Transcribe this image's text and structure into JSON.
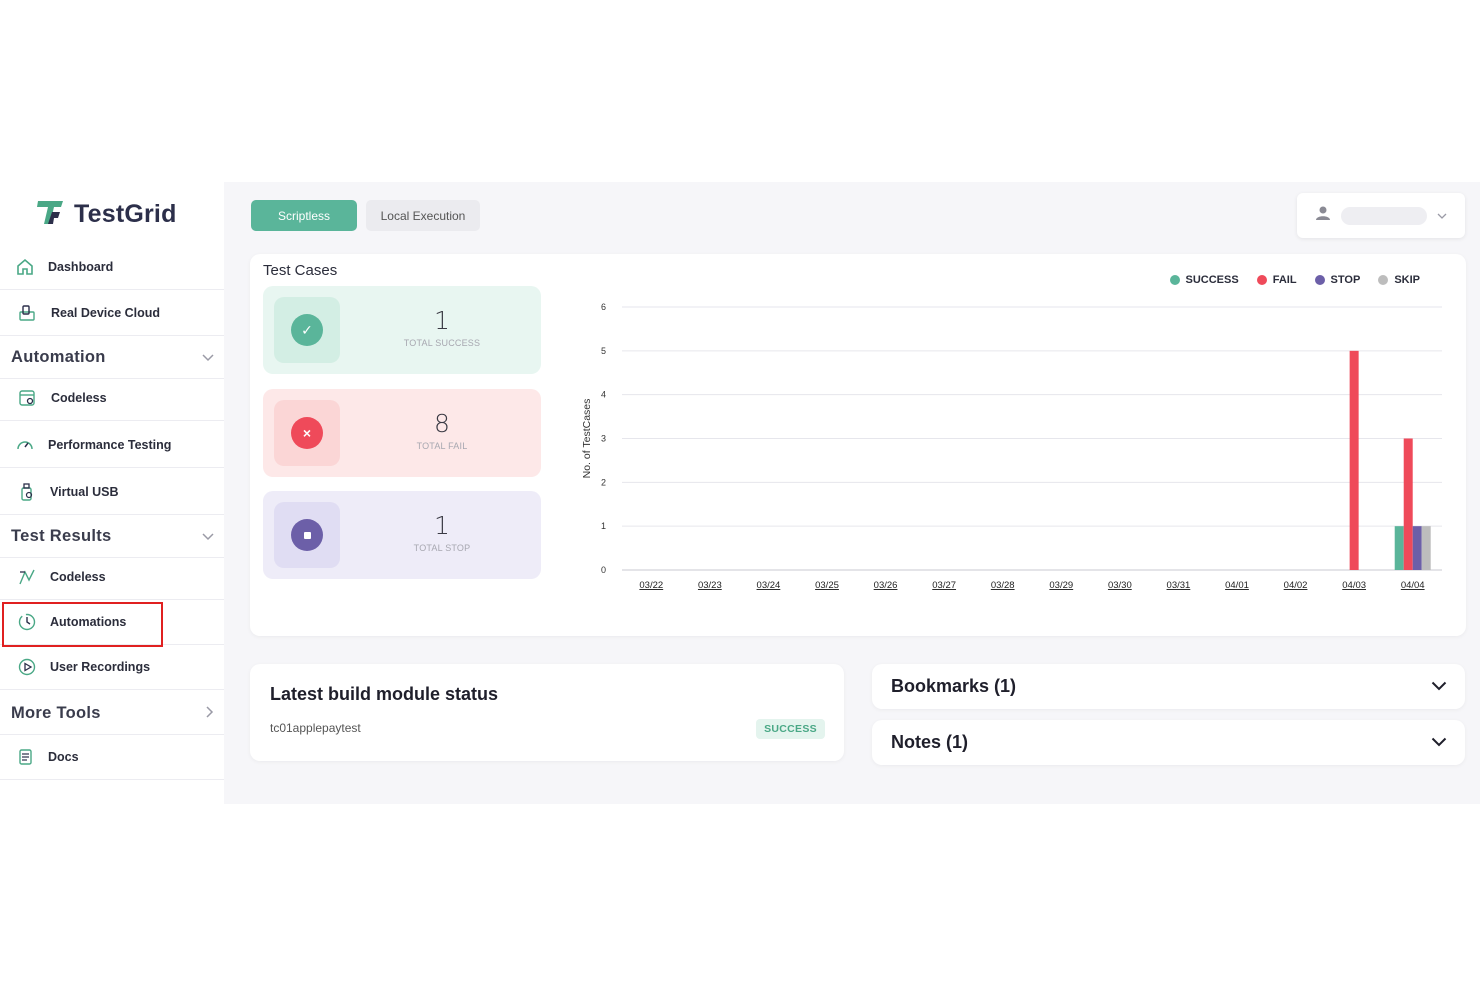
{
  "brand": {
    "name": "TestGrid",
    "accent": "#5ab59a"
  },
  "sidebar": {
    "items": [
      {
        "label": "Dashboard",
        "icon": "home-icon"
      },
      {
        "label": "Real Device Cloud",
        "icon": "devices-icon"
      }
    ],
    "sections": [
      {
        "label": "Automation",
        "items": [
          {
            "label": "Codeless",
            "icon": "codeless-icon"
          },
          {
            "label": "Performance Testing",
            "icon": "gauge-icon"
          },
          {
            "label": "Virtual USB",
            "icon": "usb-icon"
          }
        ]
      },
      {
        "label": "Test Results",
        "items": [
          {
            "label": "Codeless",
            "icon": "codeless-results-icon"
          },
          {
            "label": "Automations",
            "icon": "clock-icon"
          },
          {
            "label": "User Recordings",
            "icon": "play-icon"
          }
        ]
      },
      {
        "label": "More Tools",
        "items": [
          {
            "label": "Docs",
            "icon": "docs-icon"
          }
        ]
      }
    ]
  },
  "tabs": {
    "scriptless": "Scriptless",
    "local": "Local Execution"
  },
  "test_cases": {
    "title": "Test Cases",
    "success": {
      "value": "1",
      "caption": "TOTAL SUCCESS",
      "color": "#5ab59a"
    },
    "fail": {
      "value": "8",
      "caption": "TOTAL FAIL",
      "color": "#ef4a5a"
    },
    "stop": {
      "value": "1",
      "caption": "TOTAL STOP",
      "color": "#6c5fa8"
    }
  },
  "chart_data": {
    "type": "bar",
    "ylabel": "No. of TestCases",
    "xlabel": "",
    "ylim": [
      0,
      6
    ],
    "yticks": [
      0,
      1,
      2,
      3,
      4,
      5,
      6
    ],
    "categories": [
      "03/22",
      "03/23",
      "03/24",
      "03/25",
      "03/26",
      "03/27",
      "03/28",
      "03/29",
      "03/30",
      "03/31",
      "04/01",
      "04/02",
      "04/03",
      "04/04"
    ],
    "series": [
      {
        "name": "SUCCESS",
        "color": "#5ab59a",
        "values": [
          0,
          0,
          0,
          0,
          0,
          0,
          0,
          0,
          0,
          0,
          0,
          0,
          0,
          1
        ]
      },
      {
        "name": "FAIL",
        "color": "#ef4a5a",
        "values": [
          0,
          0,
          0,
          0,
          0,
          0,
          0,
          0,
          0,
          0,
          0,
          0,
          5,
          3
        ]
      },
      {
        "name": "STOP",
        "color": "#6c5fa8",
        "values": [
          0,
          0,
          0,
          0,
          0,
          0,
          0,
          0,
          0,
          0,
          0,
          0,
          0,
          1
        ]
      },
      {
        "name": "SKIP",
        "color": "#bdbdbd",
        "values": [
          0,
          0,
          0,
          0,
          0,
          0,
          0,
          0,
          0,
          0,
          0,
          0,
          0,
          1
        ]
      }
    ],
    "grid": true,
    "legend": "top-right"
  },
  "build": {
    "title": "Latest build module status",
    "name": "tc01applepaytest",
    "status": "SUCCESS"
  },
  "accordions": {
    "bookmarks": "Bookmarks (1)",
    "notes": "Notes (1)"
  }
}
